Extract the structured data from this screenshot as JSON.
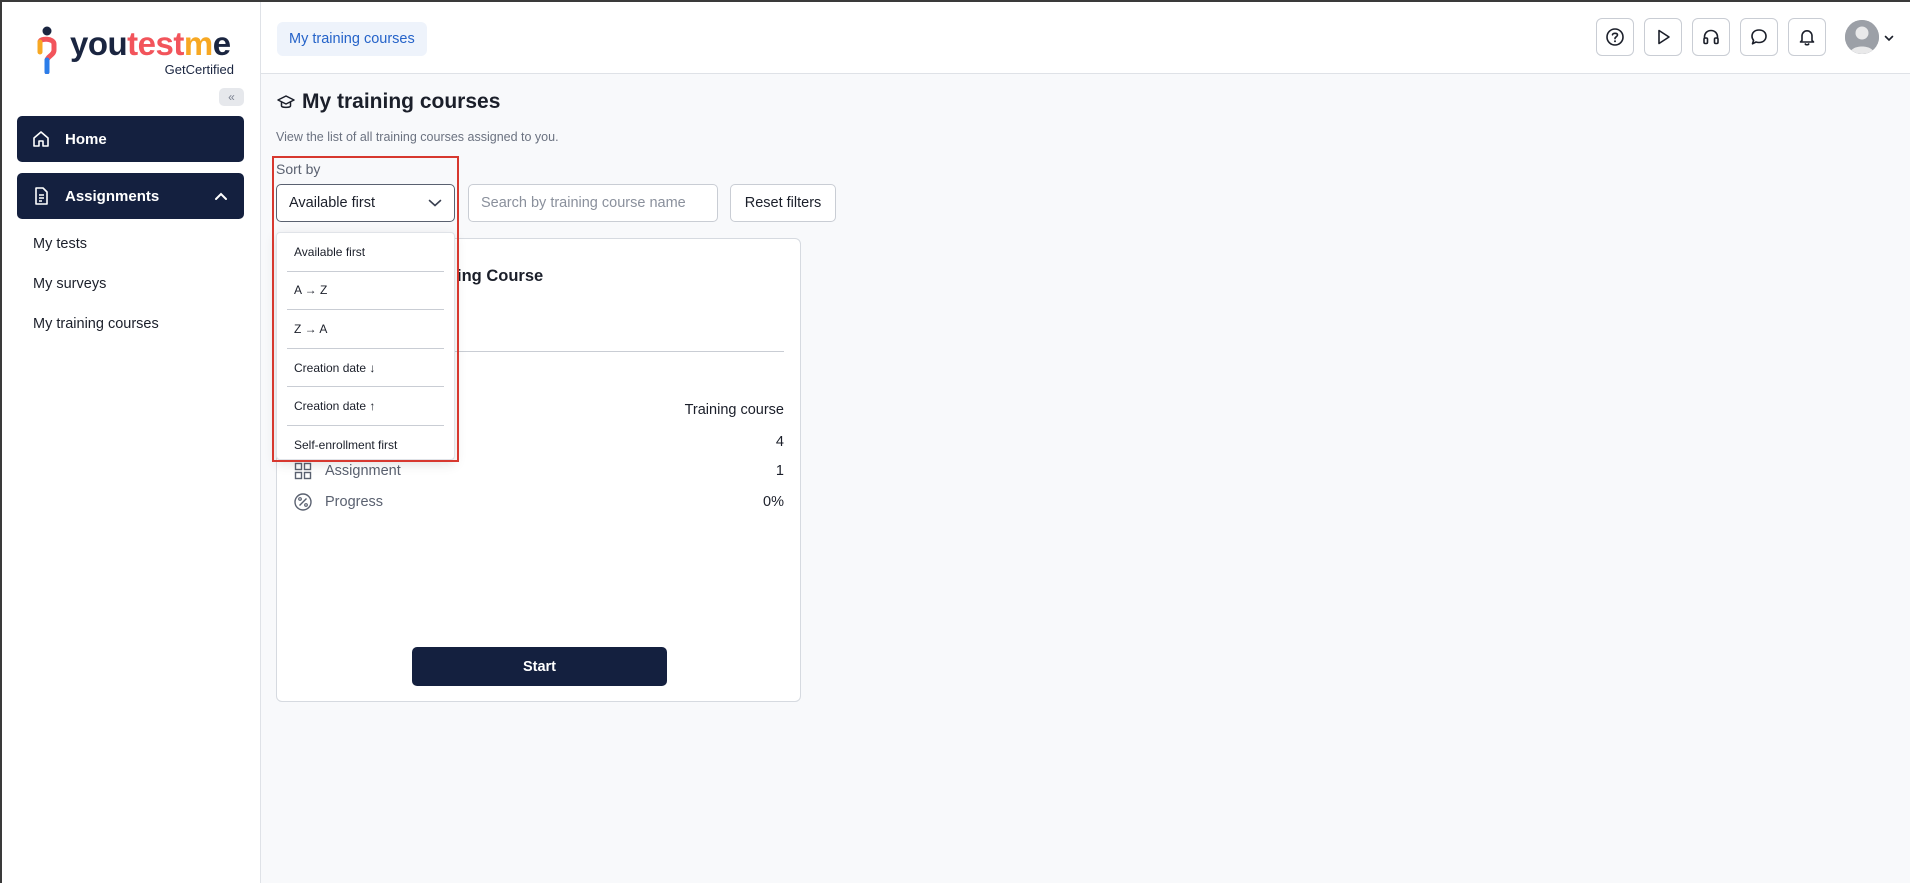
{
  "brand": {
    "name_parts": [
      "you",
      "test",
      "m",
      "e"
    ],
    "tagline": "GetCertified",
    "colors": {
      "navy": "#14203f",
      "red": "#f2545b",
      "orange": "#f7a823",
      "link": "#2563c9",
      "highlight": "#d7382f"
    }
  },
  "sidebar": {
    "collapse_icon": "double-chevron-left-icon",
    "home": {
      "label": "Home",
      "icon": "home-icon"
    },
    "assignments": {
      "label": "Assignments",
      "icon": "document-icon",
      "expanded": true
    },
    "subitems": [
      {
        "label": "My tests"
      },
      {
        "label": "My surveys"
      },
      {
        "label": "My training courses"
      }
    ]
  },
  "topbar": {
    "breadcrumb": "My training courses",
    "icons": [
      "help-icon",
      "play-icon",
      "headset-icon",
      "chat-icon",
      "bell-icon"
    ],
    "avatar_icon": "user-avatar"
  },
  "main": {
    "title": "My training courses",
    "title_icon": "graduation-cap-icon",
    "description": "View the list of all training courses assigned to you.",
    "sort": {
      "label": "Sort by",
      "selected": "Available first",
      "options": [
        "Available first",
        "A → Z",
        "Z → A",
        "Creation date ↓",
        "Creation date ↑",
        "Self-enrollment first"
      ]
    },
    "search": {
      "placeholder": "Search by training course name",
      "value": ""
    },
    "reset_label": "Reset filters"
  },
  "card": {
    "title_visible": "ing Course",
    "type": "Training course",
    "rows": [
      {
        "label": "",
        "value": "4",
        "icon": ""
      },
      {
        "label": "Assignment",
        "value": "1",
        "icon": "grid-icon"
      },
      {
        "label": "Progress",
        "value": "0%",
        "icon": "percent-icon"
      }
    ],
    "start_label": "Start"
  }
}
